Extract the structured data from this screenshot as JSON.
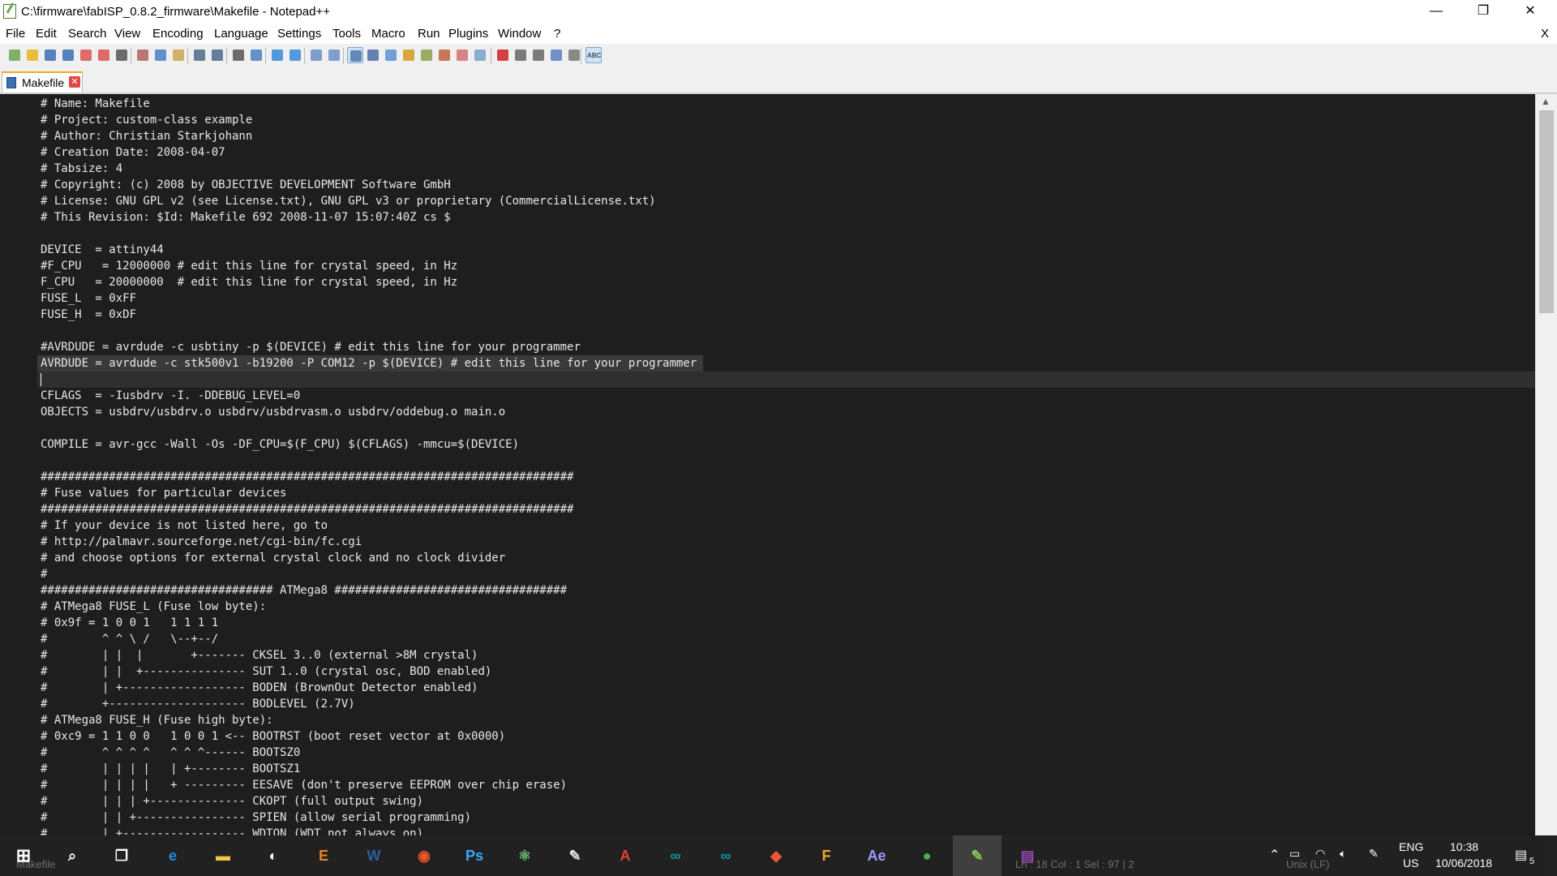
{
  "window": {
    "title": "C:\\firmware\\fabISP_0.8.2_firmware\\Makefile - Notepad++",
    "minimize_glyph": "—",
    "restore_glyph": "❐",
    "close_glyph": "✕"
  },
  "menu": {
    "items": [
      "File",
      "Edit",
      "Search",
      "View",
      "Encoding",
      "Language",
      "Settings",
      "Tools",
      "Macro",
      "Run",
      "Plugins",
      "Window",
      "?"
    ],
    "close_glyph": "X"
  },
  "toolbar": {
    "icons": [
      "new-file-icon",
      "open-file-icon",
      "save-icon",
      "save-all-icon",
      "close-icon",
      "close-all-icon",
      "print-icon",
      "cut-icon",
      "copy-icon",
      "paste-icon",
      "undo-icon",
      "redo-icon",
      "find-icon",
      "replace-icon",
      "zoom-in-icon",
      "zoom-out-icon",
      "sync-vertical-icon",
      "sync-horizontal-icon",
      "word-wrap-icon",
      "show-all-chars-icon",
      "indent-guide-icon",
      "user-lang-icon",
      "doc-map-icon",
      "function-list-icon",
      "folder-workspace-icon",
      "monitor-icon",
      "record-macro-icon",
      "stop-macro-icon",
      "play-macro-icon",
      "run-macro-multiple-icon",
      "save-macro-icon",
      "spellcheck-icon"
    ],
    "spellcheck_label": "ABC"
  },
  "tab": {
    "label": "Makefile",
    "close_glyph": "✕"
  },
  "editor": {
    "current_line": 17,
    "lines": [
      "# Name: Makefile",
      "# Project: custom-class example",
      "# Author: Christian Starkjohann",
      "# Creation Date: 2008-04-07",
      "# Tabsize: 4",
      "# Copyright: (c) 2008 by OBJECTIVE DEVELOPMENT Software GmbH",
      "# License: GNU GPL v2 (see License.txt), GNU GPL v3 or proprietary (CommercialLicense.txt)",
      "# This Revision: $Id: Makefile 692 2008-11-07 15:07:40Z cs $",
      "",
      "DEVICE  = attiny44",
      "#F_CPU   = 12000000 # edit this line for crystal speed, in Hz",
      "F_CPU   = 20000000  # edit this line for crystal speed, in Hz",
      "FUSE_L  = 0xFF",
      "FUSE_H  = 0xDF",
      "",
      "#AVRDUDE = avrdude -c usbtiny -p $(DEVICE) # edit this line for your programmer",
      "AVRDUDE = avrdude -c stk500v1 -b19200 -P COM12 -p $(DEVICE) # edit this line for your programmer",
      "",
      "CFLAGS  = -Iusbdrv -I. -DDEBUG_LEVEL=0",
      "OBJECTS = usbdrv/usbdrv.o usbdrv/usbdrvasm.o usbdrv/oddebug.o main.o",
      "",
      "COMPILE = avr-gcc -Wall -Os -DF_CPU=$(F_CPU) $(CFLAGS) -mmcu=$(DEVICE)",
      "",
      "##############################################################################",
      "# Fuse values for particular devices",
      "##############################################################################",
      "# If your device is not listed here, go to",
      "# http://palmavr.sourceforge.net/cgi-bin/fc.cgi",
      "# and choose options for external crystal clock and no clock divider",
      "#",
      "################################## ATMega8 ##################################",
      "# ATMega8 FUSE_L (Fuse low byte):",
      "# 0x9f = 1 0 0 1   1 1 1 1",
      "#        ^ ^ \\ /   \\--+--/",
      "#        | |  |       +------- CKSEL 3..0 (external >8M crystal)",
      "#        | |  +--------------- SUT 1..0 (crystal osc, BOD enabled)",
      "#        | +------------------ BODEN (BrownOut Detector enabled)",
      "#        +-------------------- BODLEVEL (2.7V)",
      "# ATMega8 FUSE_H (Fuse high byte):",
      "# 0xc9 = 1 1 0 0   1 0 0 1 <-- BOOTRST (boot reset vector at 0x0000)",
      "#        ^ ^ ^ ^   ^ ^ ^------ BOOTSZ0",
      "#        | | | |   | +-------- BOOTSZ1",
      "#        | | | |   + --------- EESAVE (don't preserve EEPROM over chip erase)",
      "#        | | | +-------------- CKOPT (full output swing)",
      "#        | | +---------------- SPIEN (allow serial programming)",
      "#        | +------------------ WDTON (WDT not always on)"
    ]
  },
  "statusbar": {
    "file_type": "Makefile",
    "position": "Ln : 18    Col : 1    Sel : 97 | 2",
    "eol": "Unix (LF)"
  },
  "taskbar": {
    "apps": [
      {
        "name": "edge-icon",
        "glyph": "e",
        "color": "#1e88e5"
      },
      {
        "name": "file-explorer-icon",
        "glyph": "▬",
        "color": "#f4c542"
      },
      {
        "name": "app-icon-circle",
        "glyph": "◐",
        "color": "#ffffff"
      },
      {
        "name": "eagle-icon",
        "glyph": "E",
        "color": "#e67e22"
      },
      {
        "name": "word-icon",
        "glyph": "W",
        "color": "#2b5797"
      },
      {
        "name": "camera-app-icon",
        "glyph": "◉",
        "color": "#f25022"
      },
      {
        "name": "photoshop-icon",
        "glyph": "Ps",
        "color": "#31a8ff"
      },
      {
        "name": "atom-icon",
        "glyph": "⚛",
        "color": "#66bb6a"
      },
      {
        "name": "inkscape-icon",
        "glyph": "✎",
        "color": "#dddddd"
      },
      {
        "name": "acrobat-icon",
        "glyph": "A",
        "color": "#e53935"
      },
      {
        "name": "arduino-icon",
        "glyph": "∞",
        "color": "#00979d"
      },
      {
        "name": "arduino-2-icon",
        "glyph": "∞",
        "color": "#00979d"
      },
      {
        "name": "git-icon",
        "glyph": "◆",
        "color": "#f05033"
      },
      {
        "name": "fusion-icon",
        "glyph": "F",
        "color": "#f5a623"
      },
      {
        "name": "after-effects-icon",
        "glyph": "Ae",
        "color": "#9999ff"
      },
      {
        "name": "chrome-icon",
        "glyph": "●",
        "color": "#4caf50"
      },
      {
        "name": "notepadpp-icon",
        "glyph": "✎",
        "color": "#8bc34a"
      },
      {
        "name": "winrar-icon",
        "glyph": "▤",
        "color": "#8e44ad"
      }
    ],
    "language_top": "ENG",
    "language_bottom": "US",
    "time": "10:38",
    "date": "10/06/2018",
    "notification_count": "5"
  },
  "colors": {
    "editor_bg": "#1e1e1e",
    "current_line_bg": "#2f2f2f",
    "taskbar_bg": "#1b1b1b"
  }
}
